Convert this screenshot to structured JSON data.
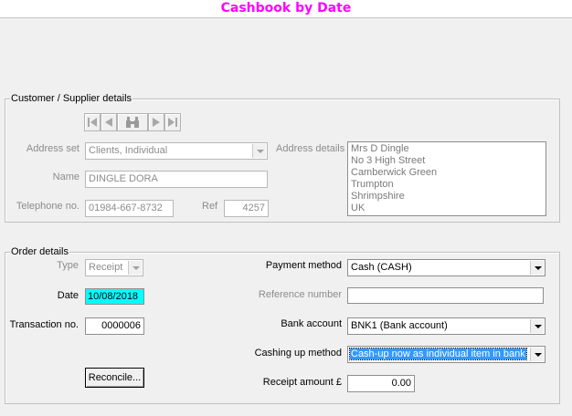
{
  "window": {
    "title": "Cashbook by Date",
    "title_color": "#ff00ff"
  },
  "customer_group": {
    "label": "Customer / Supplier details",
    "nav_buttons": [
      "first-record-icon",
      "previous-record-icon",
      "binoculars-icon",
      "next-record-icon",
      "last-record-icon"
    ],
    "address_set": {
      "label": "Address set",
      "value": "Clients, Individual"
    },
    "name": {
      "label": "Name",
      "value": "DINGLE DORA"
    },
    "telephone": {
      "label": "Telephone no.",
      "value": "01984-667-8732"
    },
    "ref": {
      "label": "Ref",
      "value": "4257"
    },
    "address_details": {
      "label": "Address details",
      "lines": [
        "Mrs D Dingle",
        "No 3 High Street",
        "Camberwick Green",
        "Trumpton",
        "Shrimpshire",
        "UK"
      ]
    }
  },
  "order_group": {
    "label": "Order details",
    "type": {
      "label": "Type",
      "value": "Receipt"
    },
    "date": {
      "label": "Date",
      "value": "10/08/2018",
      "highlight_color": "#00ffff"
    },
    "transaction": {
      "label": "Transaction no.",
      "value": "0000006"
    },
    "reconcile_button": "Reconcile...",
    "payment_method": {
      "label": "Payment method",
      "value": "Cash (CASH)"
    },
    "reference_number": {
      "label": "Reference number",
      "value": ""
    },
    "bank_account": {
      "label": "Bank account",
      "value": "BNK1 (Bank account)"
    },
    "cashing_up_method": {
      "label": "Cashing up method",
      "value": "Cash-up now as individual item in bank"
    },
    "receipt_amount": {
      "label": "Receipt amount £",
      "value": "0.00"
    }
  }
}
